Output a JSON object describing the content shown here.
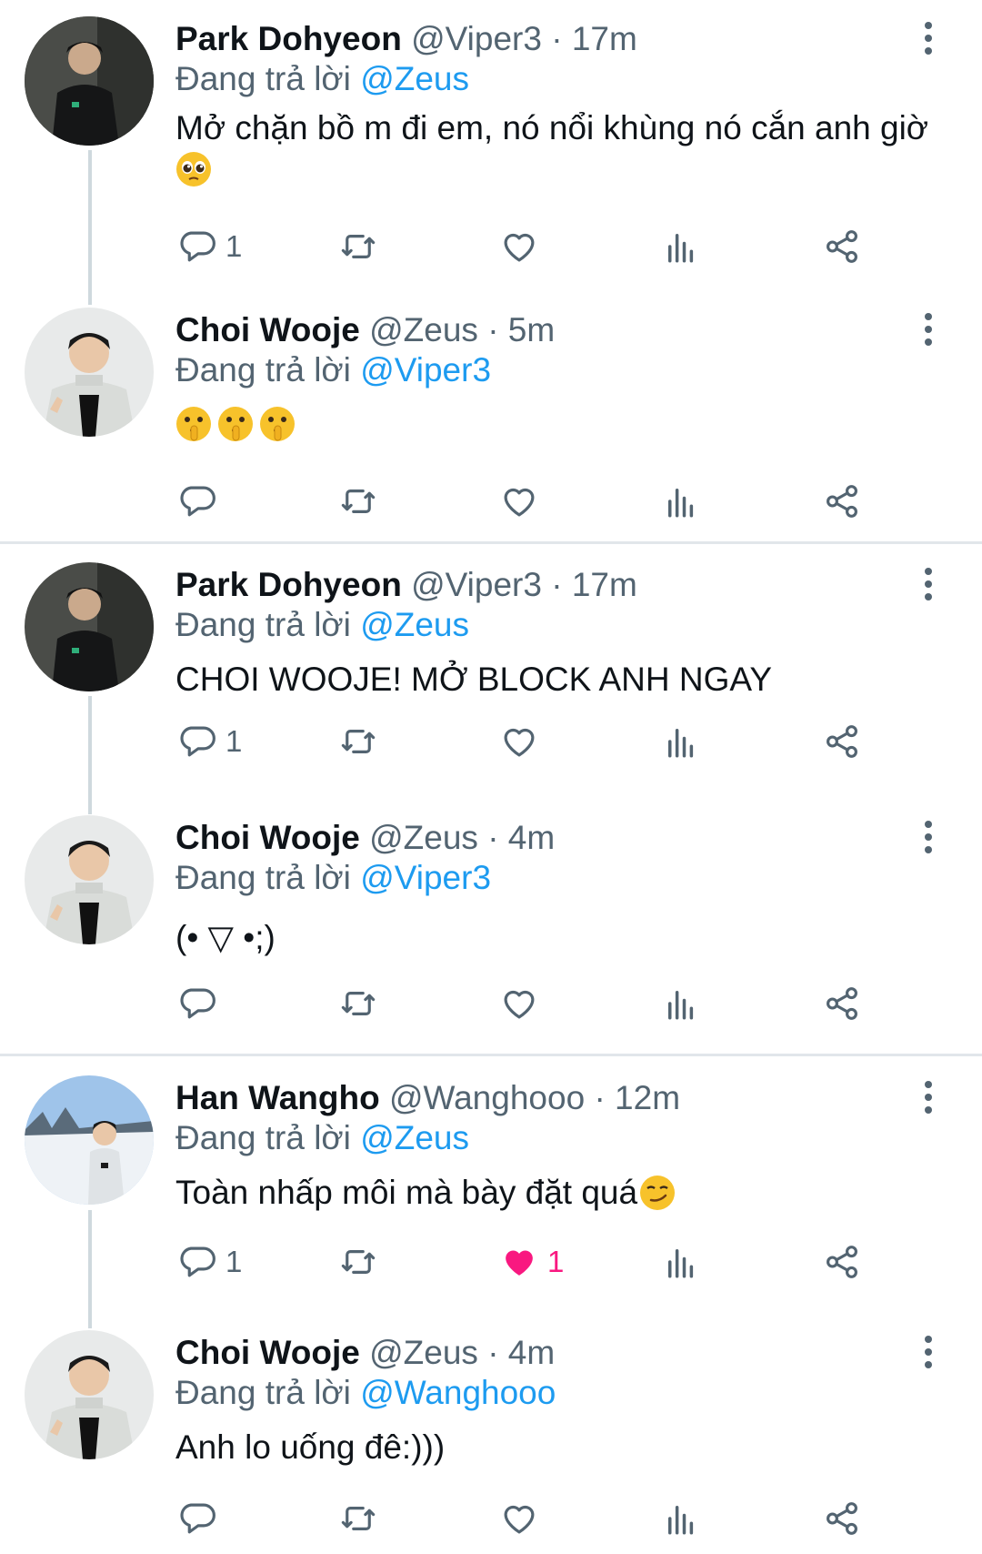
{
  "replying_prefix": "Đang trả lời",
  "tweets": [
    {
      "name": "Park Dohyeon",
      "handle": "@Viper3",
      "sep": "·",
      "time": "17m",
      "reply_to": "@Zeus",
      "text": "Mở chặn bồ m đi em, nó nổi khùng nó cắn anh giờ",
      "emoji": [
        "pleading-face-emoji"
      ],
      "replies": "1",
      "likes": ""
    },
    {
      "name": "Choi Wooje",
      "handle": "@Zeus",
      "sep": "·",
      "time": "5m",
      "reply_to": "@Viper3",
      "text": "",
      "emoji": [
        "shushing-face-emoji",
        "shushing-face-emoji",
        "shushing-face-emoji"
      ],
      "replies": "",
      "likes": ""
    },
    {
      "name": "Park Dohyeon",
      "handle": "@Viper3",
      "sep": "·",
      "time": "17m",
      "reply_to": "@Zeus",
      "text": "CHOI WOOJE! MỞ BLOCK ANH NGAY",
      "emoji": [],
      "replies": "1",
      "likes": ""
    },
    {
      "name": "Choi Wooje",
      "handle": "@Zeus",
      "sep": "·",
      "time": "4m",
      "reply_to": "@Viper3",
      "text": "(• ▽ •;)",
      "emoji": [],
      "replies": "",
      "likes": ""
    },
    {
      "name": "Han Wangho",
      "handle": "@Wanghooo",
      "sep": "·",
      "time": "12m",
      "reply_to": "@Zeus",
      "text": "Toàn nhấp môi mà bày đặt quá",
      "emoji": [
        "smirking-face-emoji"
      ],
      "replies": "1",
      "likes": "1",
      "liked": true
    },
    {
      "name": "Choi Wooje",
      "handle": "@Zeus",
      "sep": "·",
      "time": "4m",
      "reply_to": "@Wanghooo",
      "text": "Anh lo uống đê:)))",
      "emoji": [],
      "replies": "",
      "likes": ""
    }
  ],
  "colors": {
    "accent": "#1d9bf0",
    "secondary": "#536471",
    "like": "#f91880",
    "divider": "#e1e6ea",
    "thread": "#cfd9de"
  },
  "icons": [
    "reply-icon",
    "retweet-icon",
    "like-icon",
    "views-icon",
    "share-icon",
    "more-icon"
  ]
}
